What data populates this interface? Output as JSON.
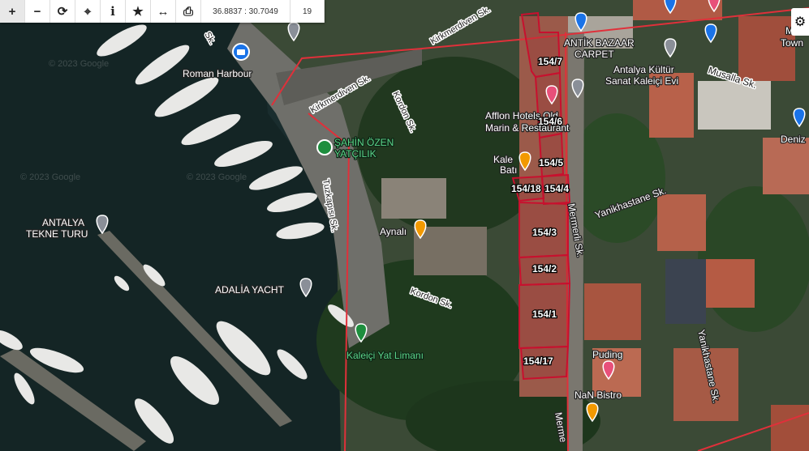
{
  "toolbar": {
    "coordinates": "36.8837 : 30.7049",
    "zoom": "19",
    "buttons": [
      "zoom-in",
      "zoom-out",
      "refresh",
      "locate",
      "info",
      "favorite",
      "measure",
      "print"
    ]
  },
  "places": {
    "roman_harbour": "Roman Harbour",
    "sahin_ozen_1": "ŞAHİN ÖZEN",
    "sahin_ozen_2": "YATÇILIK",
    "antalya_tekne_1": "ANTALYA",
    "antalya_tekne_2": "TEKNE TURU",
    "adalia_yacht": "ADALİA YACHT",
    "kaleici_yat": "Kaleiçi Yat Limanı",
    "aynali": "Aynalı",
    "kale_bati_1": "Kale",
    "kale_bati_2": "Batı",
    "afflon_1": "Afflon Hotels Old",
    "afflon_2": "Marin & Restaurant",
    "antik_bazaar_1": "ANTİK BAZAAR",
    "antik_bazaar_2": "CARPET",
    "antalya_kultur_1": "Antalya Kültür",
    "antalya_kultur_2": "Sanat Kaleiçi Evi",
    "puding": "Puding",
    "nan_bistro": "NaN Bistro",
    "deniz": "Deniz",
    "m_town_1": "M",
    "m_town_2": "Town"
  },
  "streets": {
    "kirkmerdiven_1": "Kirkmerdiven Sk.",
    "kirkmerdiven_2": "Kirkmerdiven Sk.",
    "kirkmerdiven_3": "Sk.",
    "kordon_1": "Kordon Sk.",
    "kordon_2": "Kordon Sk.",
    "tuzkapisi": "Tuzkapısı Sk.",
    "musalla": "Musalla Sk.",
    "yanikhastane_1": "Yanikhastane Sk.",
    "yanikhastane_2": "Yanikhastane Sk.",
    "mermerli_1": "Mermerli Sk.",
    "mermerli_2": "Merme"
  },
  "parcels": [
    "154/7",
    "154/6",
    "154/5",
    "154/18",
    "154/4",
    "154/3",
    "154/2",
    "154/1",
    "154/17"
  ],
  "watermarks": [
    "© 2023 Google",
    "© 2023 Google",
    "© 2023 Google"
  ],
  "colors": {
    "parcel_line": "#c8102e",
    "boundary_line": "#e0303a",
    "poi_orange": "#f29900",
    "poi_gray": "#8a8f98",
    "poi_pink": "#e8507a",
    "poi_green": "#1e8e3e",
    "poi_blue": "#1a73e8"
  },
  "icons": {
    "settings": "gear-icon"
  }
}
